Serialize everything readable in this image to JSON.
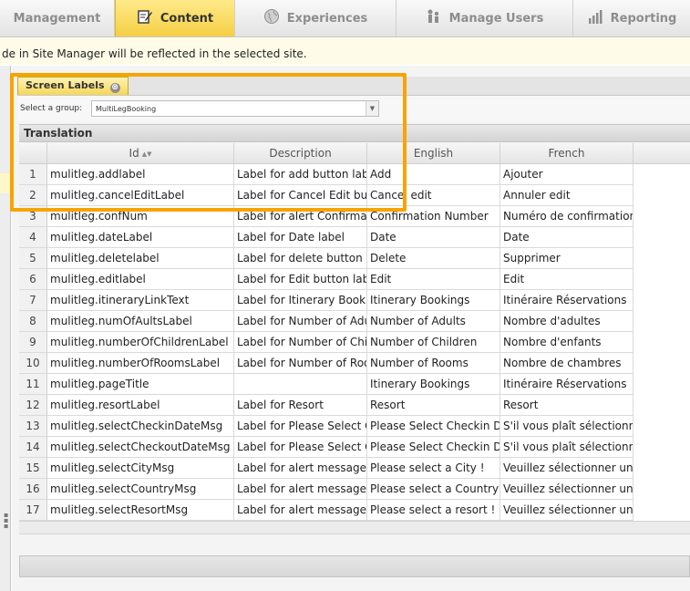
{
  "nav": {
    "tabs": [
      {
        "label": "Management",
        "icon": "management-icon",
        "active": false
      },
      {
        "label": "Content",
        "icon": "content-edit-icon",
        "active": true
      },
      {
        "label": "Experiences",
        "icon": "globe-icon",
        "active": false
      },
      {
        "label": "Manage Users",
        "icon": "users-icon",
        "active": false
      },
      {
        "label": "Reporting",
        "icon": "bar-chart-icon",
        "active": false
      }
    ]
  },
  "info": {
    "message": "de in Site Manager will be reflected in the selected site."
  },
  "panel": {
    "tab_label": "Screen Labels",
    "close_glyph": "⊗",
    "group_label": "Select a group:",
    "group_value": "MultiLegBooking",
    "section_title": "Translation"
  },
  "grid": {
    "columns": [
      "",
      "Id",
      "Description",
      "English",
      "French"
    ],
    "rows": [
      [
        "1",
        "mulitleg.addlabel",
        "Label for add button label",
        "Add",
        "Ajouter"
      ],
      [
        "2",
        "mulitleg.cancelEditLabel",
        "Label for Cancel Edit button",
        "Cancel edit",
        "Annuler edit"
      ],
      [
        "3",
        "mulitleg.confNum",
        "Label for alert Confirmation",
        "Confirmation Number",
        "Numéro de confirmation"
      ],
      [
        "4",
        "mulitleg.dateLabel",
        "Label for Date label",
        " Date",
        " Date"
      ],
      [
        "5",
        "mulitleg.deletelabel",
        "Label for delete button label",
        "Delete",
        "Supprimer"
      ],
      [
        "6",
        "mulitleg.editlabel",
        "Label for Edit button label",
        "Edit",
        "Edit"
      ],
      [
        "7",
        "mulitleg.itineraryLinkText",
        "Label for Itinerary Bookings",
        "Itinerary Bookings",
        "Itinéraire Réservations"
      ],
      [
        "8",
        "mulitleg.numOfAultsLabel",
        "Label for Number of Adults",
        "Number of Adults",
        "Nombre d'adultes"
      ],
      [
        "9",
        "mulitleg.numberOfChildrenLabel",
        "Label for Number of Children",
        "Number of Children",
        "Nombre d'enfants"
      ],
      [
        "10",
        "mulitleg.numberOfRoomsLabel",
        "Label for Number of Rooms",
        "Number of Rooms",
        "Nombre de chambres"
      ],
      [
        "11",
        "mulitleg.pageTitle",
        "",
        "Itinerary Bookings",
        "Itinéraire Réservations"
      ],
      [
        "12",
        "mulitleg.resortLabel",
        "Label for Resort",
        "Resort",
        "Resort"
      ],
      [
        "13",
        "mulitleg.selectCheckinDateMsg",
        "Label for Please Select Checkin",
        "Please Select Checkin Date",
        "S'il vous plaît sélectionnez"
      ],
      [
        "14",
        "mulitleg.selectCheckoutDateMsg",
        "Label for Please Select Checkout",
        "Please Select Checkin Date",
        "S'il vous plaît sélectionnez"
      ],
      [
        "15",
        "mulitleg.selectCityMsg",
        "Label for alert message label",
        "Please select a City !",
        "Veuillez sélectionner une"
      ],
      [
        "16",
        "mulitleg.selectCountryMsg",
        "Label for alert message label",
        "Please select a Country !",
        "Veuillez sélectionner un pays"
      ],
      [
        "17",
        "mulitleg.selectResortMsg",
        "Label for alert message label",
        "Please select a resort !",
        "Veuillez sélectionner un centre"
      ]
    ]
  },
  "colors": {
    "accent": "#f5cf43",
    "callout": "#f7a400"
  }
}
